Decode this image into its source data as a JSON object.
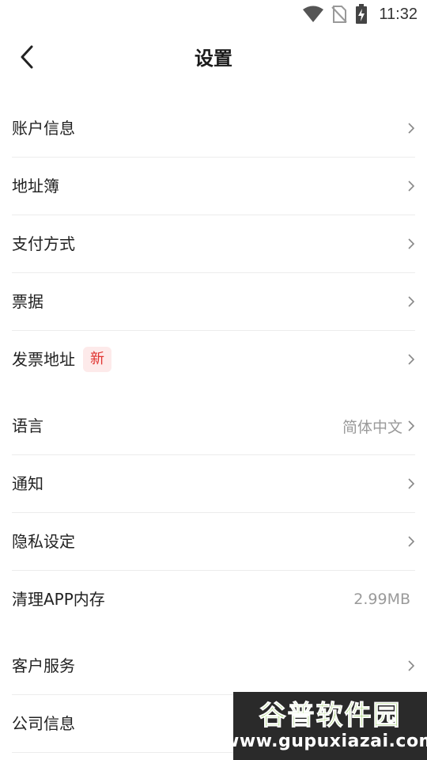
{
  "status_bar": {
    "time": "11:32",
    "icons": [
      "wifi-icon",
      "no-sim-icon",
      "battery-charging-icon"
    ]
  },
  "header": {
    "title": "设置",
    "back_icon": "chevron-left-icon"
  },
  "groups": [
    {
      "items": [
        {
          "label": "账户信息"
        },
        {
          "label": "地址簿"
        },
        {
          "label": "支付方式"
        },
        {
          "label": "票据"
        },
        {
          "label": "发票地址",
          "badge": "新"
        }
      ]
    },
    {
      "items": [
        {
          "label": "语言",
          "value": "简体中文"
        },
        {
          "label": "通知"
        },
        {
          "label": "隐私设定"
        },
        {
          "label": "清理APP内存",
          "value": "2.99MB"
        }
      ]
    },
    {
      "items": [
        {
          "label": "客户服务"
        },
        {
          "label": "公司信息"
        }
      ]
    }
  ],
  "watermark": {
    "title": "谷普软件园",
    "url": "www.gupuxiazai.com"
  },
  "colors": {
    "badge_bg": "#fdeaea",
    "badge_text": "#e0322f",
    "divider": "#ececec",
    "value_text": "#9a9a9a"
  }
}
